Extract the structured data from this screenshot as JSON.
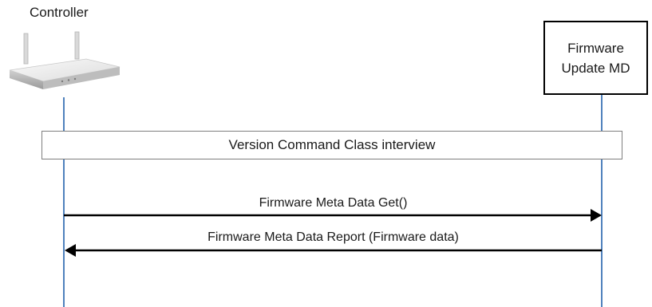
{
  "controller": {
    "label": "Controller",
    "icon": "router-icon"
  },
  "firmware_device": {
    "line1": "Firmware",
    "line2": "Update MD"
  },
  "interview": {
    "label": "Version Command  Class interview"
  },
  "messages": [
    {
      "label": "Firmware Meta Data Get()",
      "direction": "controller-to-device"
    },
    {
      "label": "Firmware Meta Data Report (Firmware data)",
      "direction": "device-to-controller"
    }
  ],
  "colors": {
    "lifeline": "#4f81bd",
    "arrow": "#000000",
    "box_border": "#000000",
    "interview_border": "#7f7f7f"
  }
}
